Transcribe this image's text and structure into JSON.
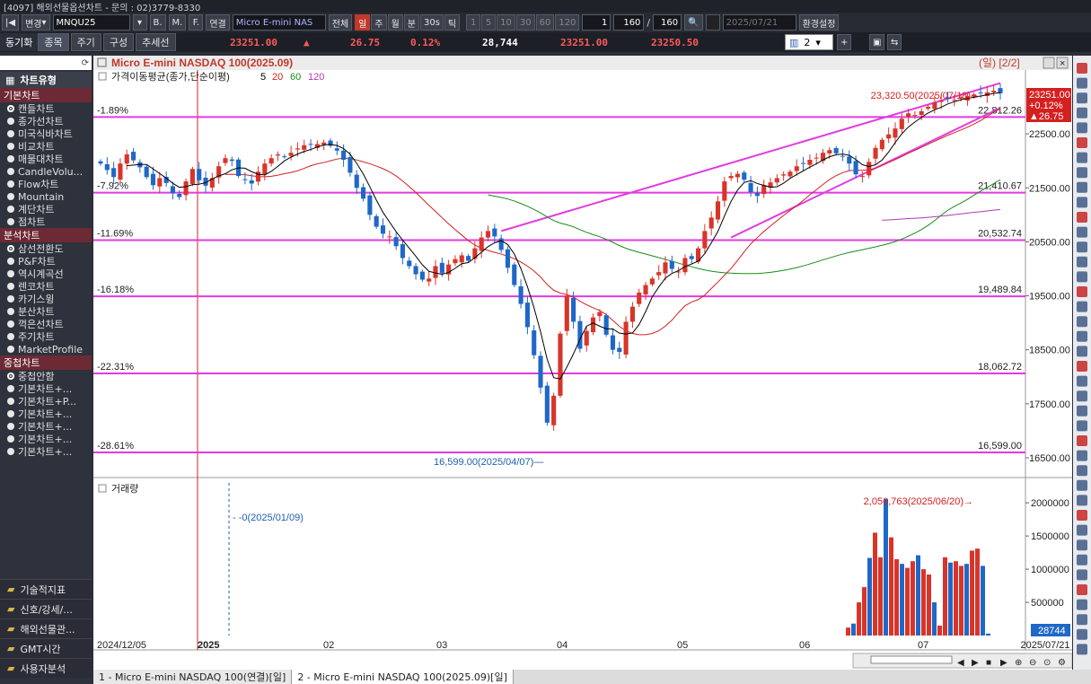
{
  "window": {
    "title": "[4097] 해외선물옵션차트 - 문의 : 02)3779-8330"
  },
  "toolbar": {
    "change_label": "변경",
    "symbol": "MNQU25",
    "btn_b": "B.",
    "btn_m": "M.",
    "btn_f": "F.",
    "link_label": "연결",
    "instrument_name": "Micro E-mini NAS",
    "all_label": "전체",
    "periods": [
      "일",
      "주",
      "월",
      "분",
      "30s",
      "틱"
    ],
    "selected_period": "일",
    "intervals": [
      "1",
      "5",
      "10",
      "30",
      "60",
      "120"
    ],
    "interval_value": "1",
    "count_value": "160",
    "count_total": "160",
    "date_value": "2025/07/21",
    "settings_label": "환경설정"
  },
  "toolbar2": {
    "sync_label": "동기화",
    "tabs": [
      "종목",
      "주기",
      "구성",
      "추세선"
    ],
    "price": "23251.00",
    "change_arrow": "▲",
    "change": "26.75",
    "change_pct": "0.12%",
    "volume": "28,744",
    "ask": "23251.00",
    "bid": "23250.50",
    "layout_count": "2"
  },
  "sidebar": {
    "chart_type_label": "차트유형",
    "groups": [
      {
        "title": "기본차트",
        "items": [
          "캔들차트",
          "종가선차트",
          "미국식바차트",
          "비교차트",
          "매물대차트",
          "CandleVolu...",
          "Flow차트",
          "Mountain",
          "계단차트",
          "점차트"
        ]
      },
      {
        "title": "분석차트",
        "items": [
          "삼선전환도",
          "P&F차트",
          "역시계곡선",
          "렌코차트",
          "카기스윙",
          "분산차트",
          "꺽은선차트",
          "주기차트",
          "MarketProfile"
        ]
      },
      {
        "title": "중첩차트",
        "items": [
          "중첩안함",
          "기본차트+...",
          "기본차트+P...",
          "기본차트+...",
          "기본차트+...",
          "기본차트+...",
          "기본차트+..."
        ]
      }
    ],
    "bottom_items": [
      "기술적지표",
      "신호/강세/...",
      "해외선물관...",
      "GMT시간",
      "사용자분석"
    ]
  },
  "chart": {
    "window_title": "Micro E-mini NASDAQ 100(2025.09)",
    "period_badge": "(일) [2/2]",
    "ma_legend": "가격이동평균(종가,단순이평)",
    "ma_periods": [
      "5",
      "20",
      "60",
      "120"
    ],
    "ma_colors": [
      "#000000",
      "#d42020",
      "#1a8a1a",
      "#b03ab0"
    ],
    "up_color": "#d8352a",
    "down_color": "#1e68c8",
    "level_color": "#e23ae2",
    "fib_levels": [
      {
        "pct": "-1.89%",
        "price": "22,812.26",
        "value": 22812.26
      },
      {
        "pct": "-7.92%",
        "price": "21,410.67",
        "value": 21410.67
      },
      {
        "pct": "-11.69%",
        "price": "20,532.74",
        "value": 20532.74
      },
      {
        "pct": "-16.18%",
        "price": "19,489.84",
        "value": 19489.84
      },
      {
        "pct": "-22.31%",
        "price": "18,062.72",
        "value": 18062.72
      },
      {
        "pct": "-28.61%",
        "price": "16,599.00",
        "value": 16599.0
      }
    ],
    "high_annotation": "23,320.50(2025/07/18)",
    "low_annotation": "16,599.00(2025/04/07)",
    "y_ticks": [
      "22500.00",
      "21500.00",
      "20500.00",
      "19500.00",
      "18500.00",
      "17500.00",
      "16500.00"
    ],
    "price_box": [
      "23251.00",
      "+0.12%",
      "▲26.75"
    ],
    "volume_title": "거래량",
    "volume_annotation": "2,056,763(2025/06/20)",
    "volume_zero_note": "0(2025/01/09)",
    "volume_ticks": [
      "2000000",
      "1500000",
      "1000000",
      "500000"
    ],
    "volume_last": "28744",
    "x_labels": [
      "2024/12/05",
      "2025",
      "02",
      "03",
      "04",
      "05",
      "06",
      "07",
      "2025/07/21"
    ]
  },
  "chart_data": {
    "type": "candlestick",
    "title": "Micro E-mini NASDAQ 100(2025.09)",
    "x_range": [
      "2024/12/05",
      "2025/07/21"
    ],
    "ylim": [
      16400,
      23450
    ],
    "close_path": [
      21950,
      21830,
      21700,
      21950,
      22120,
      22010,
      21880,
      21700,
      21550,
      21680,
      21590,
      21400,
      21330,
      21620,
      21850,
      21640,
      21540,
      21680,
      21900,
      22050,
      22000,
      21720,
      21650,
      21580,
      21800,
      21950,
      22050,
      22120,
      22080,
      22150,
      22230,
      22290,
      22300,
      22310,
      22340,
      22280,
      22190,
      22020,
      21780,
      21500,
      21300,
      21000,
      20780,
      20650,
      20600,
      20420,
      20200,
      20050,
      19900,
      19800,
      19820,
      20050,
      19920,
      20080,
      20180,
      20250,
      20150,
      20380,
      20580,
      20700,
      20600,
      20350,
      20020,
      19700,
      19350,
      18920,
      18400,
      17800,
      17150,
      17650,
      18800,
      19500,
      19020,
      18520,
      18850,
      19100,
      19200,
      18780,
      18500,
      18460,
      19020,
      19300,
      19560,
      19700,
      19820,
      19940,
      20120,
      20000,
      19950,
      20200,
      20180,
      20380,
      20700,
      20950,
      21250,
      21620,
      21720,
      21760,
      21650,
      21420,
      21350,
      21550,
      21600,
      21680,
      21750,
      21800,
      21900,
      21950,
      22020,
      22060,
      22150,
      22200,
      22140,
      22080,
      21950,
      21750,
      21720,
      21980,
      22240,
      22390,
      22490,
      22600,
      22780,
      22880,
      22850,
      22920,
      23000,
      23080,
      23120,
      23150,
      23130,
      23180,
      23200,
      23230,
      23250,
      23270,
      23300,
      23251
    ],
    "annotations": {
      "high": 23320.5,
      "low": 16599.0
    },
    "volume": {
      "peak": 2056763,
      "peak_date": "2025/06/20",
      "last": 28744
    }
  }
}
